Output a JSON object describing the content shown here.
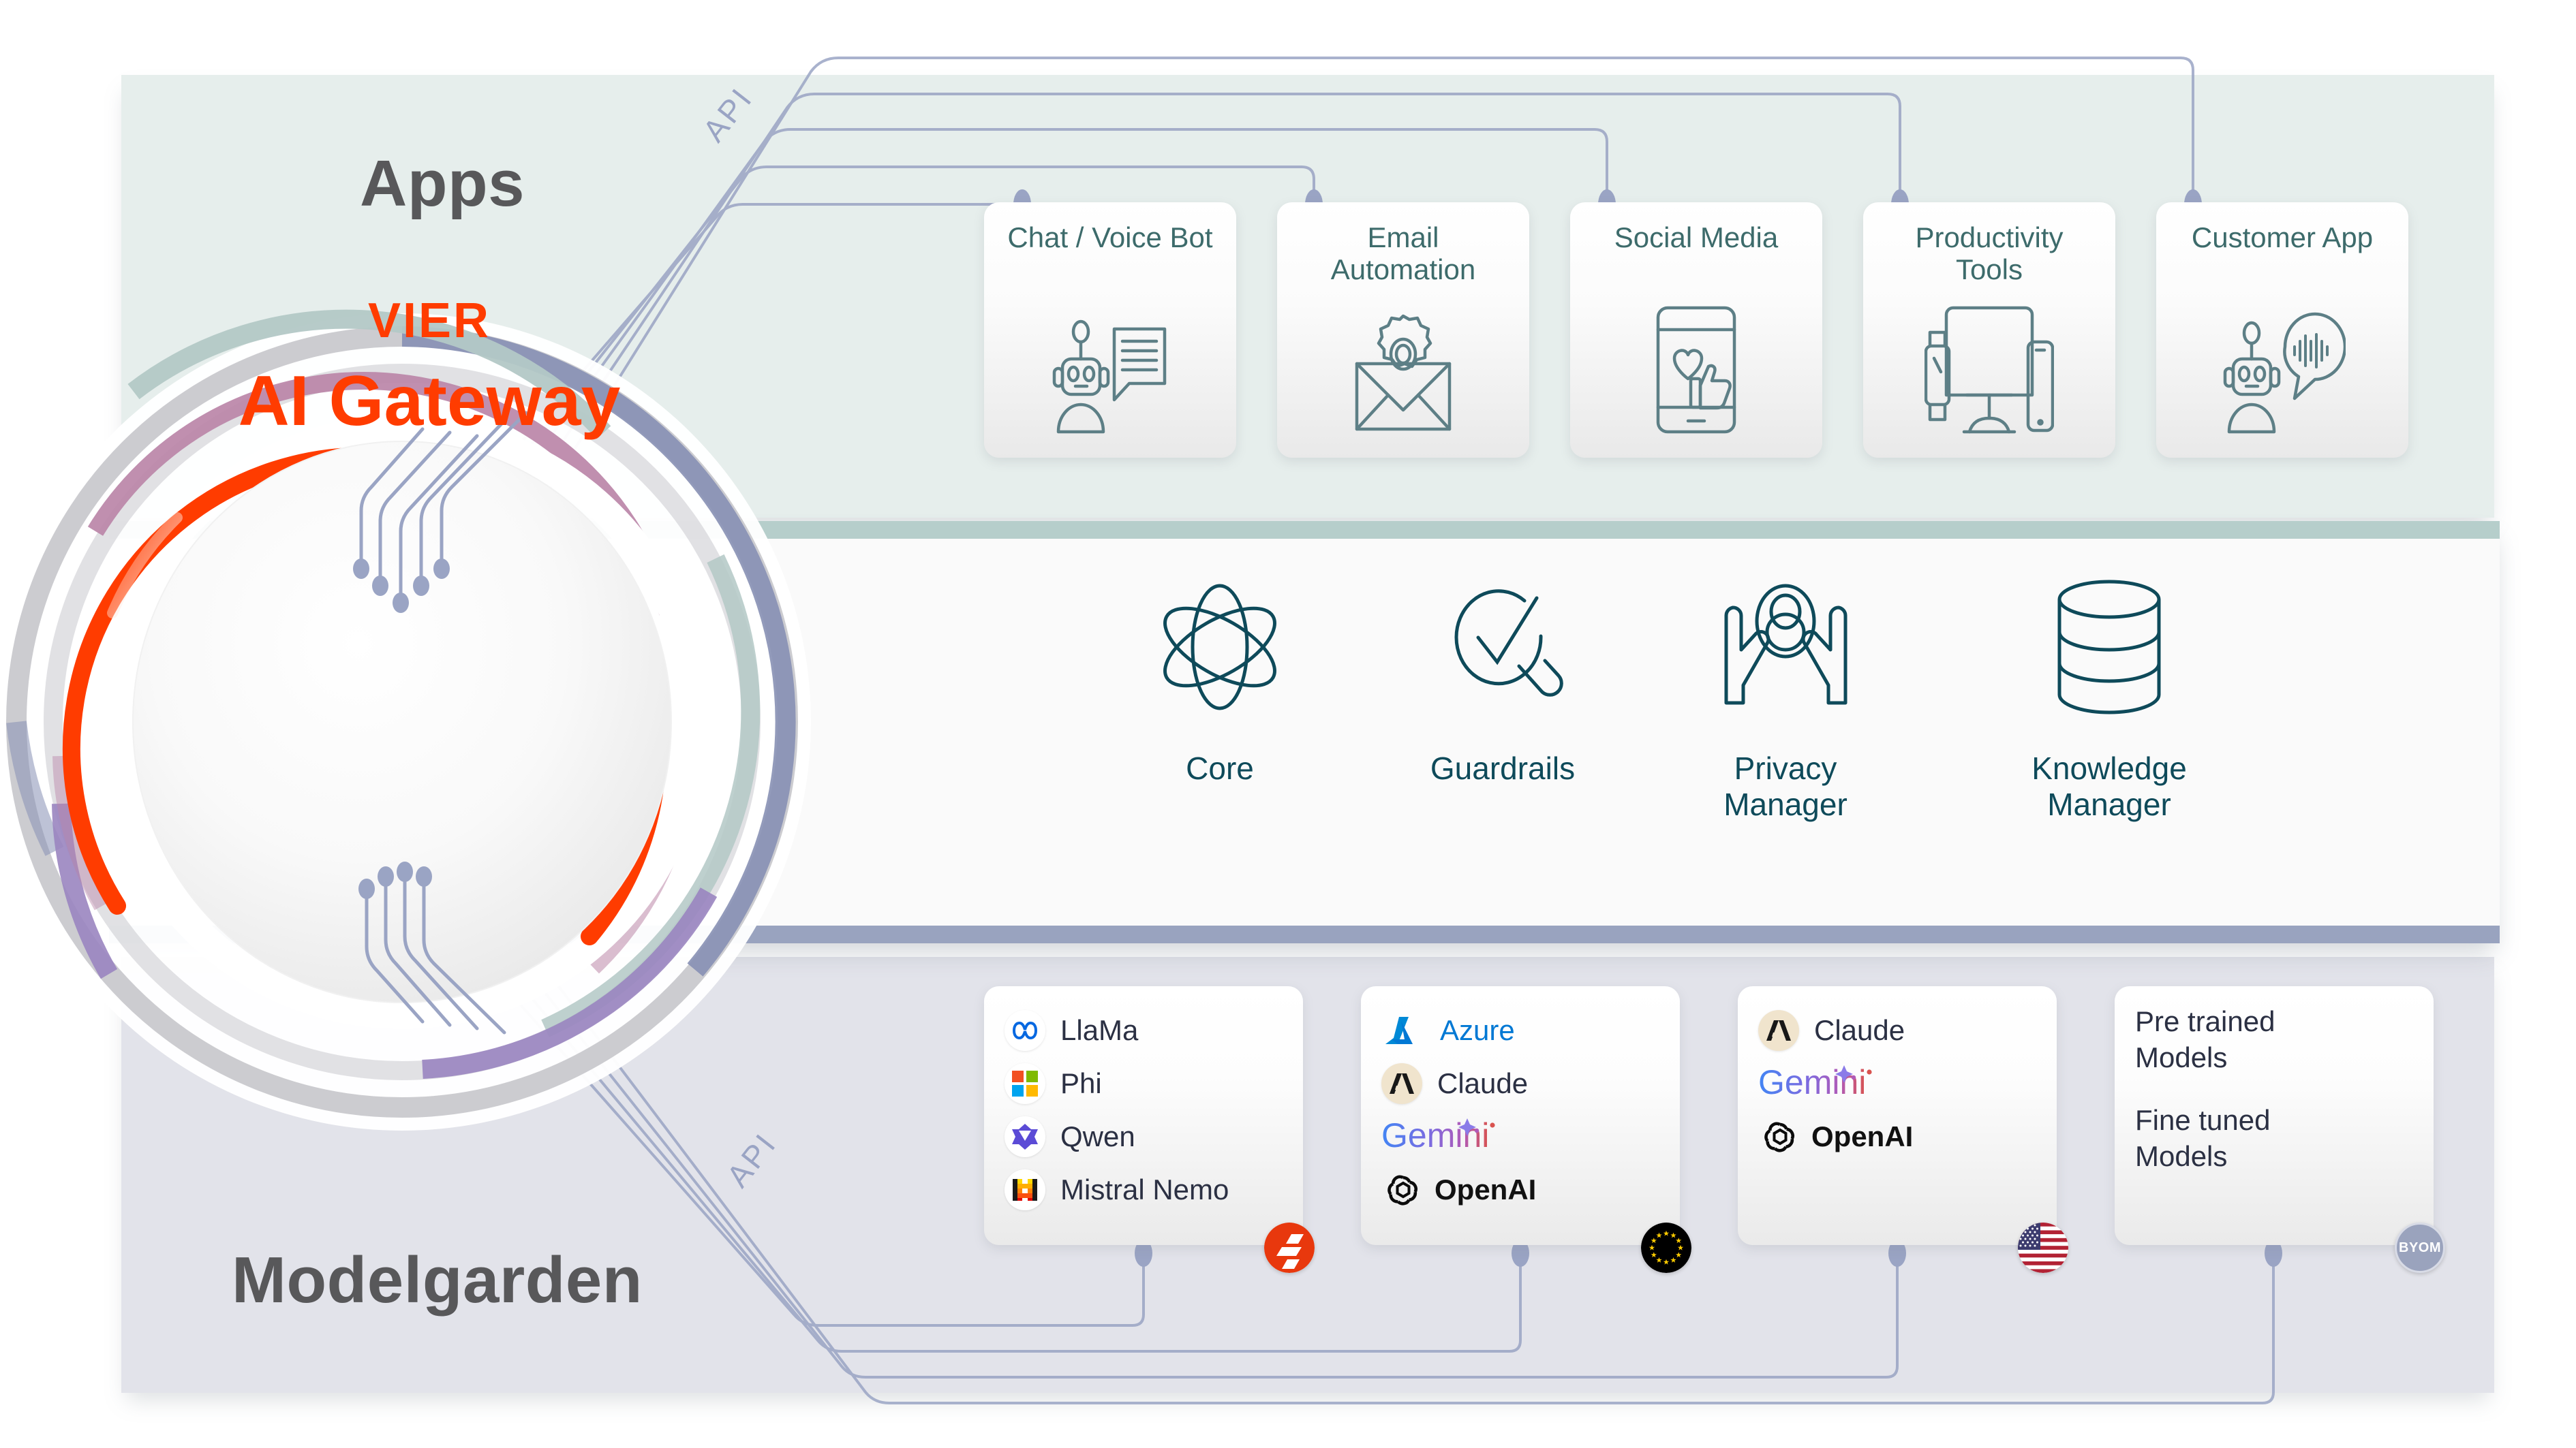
{
  "bands": {
    "apps": {
      "title": "Apps",
      "api_label": "API"
    },
    "gateway": {
      "brand": "VIER",
      "name": "AI Gateway"
    },
    "modelgarden": {
      "title": "Modelgarden",
      "api_label": "API"
    }
  },
  "apps": [
    {
      "label": "Chat / Voice Bot",
      "icon": "robot-chat-icon"
    },
    {
      "label": "Email\nAutomation",
      "label_line1": "Email",
      "label_line2": "Automation",
      "icon": "envelope-gear-icon"
    },
    {
      "label": "Social Media",
      "icon": "phone-heart-thumb-icon"
    },
    {
      "label": "Productivity\nTools",
      "label_line1": "Productivity",
      "label_line2": "Tools",
      "icon": "devices-icon"
    },
    {
      "label": "Customer App",
      "icon": "robot-voice-icon"
    }
  ],
  "gateway_features": [
    {
      "label": "Core",
      "icon": "atom-icon"
    },
    {
      "label": "Guardrails",
      "icon": "check-magnifier-icon"
    },
    {
      "label_line1": "Privacy",
      "label_line2": "Manager",
      "icon": "hands-person-icon"
    },
    {
      "label_line1": "Knowledge",
      "label_line2": "Manager",
      "icon": "database-icon"
    }
  ],
  "model_cards": [
    {
      "badge": "vier-logo-badge",
      "models": [
        {
          "name": "LlaMa",
          "logo": "meta-logo-icon",
          "bold": false
        },
        {
          "name": "Phi",
          "logo": "microsoft-logo-icon",
          "bold": false
        },
        {
          "name": "Qwen",
          "logo": "qwen-logo-icon",
          "bold": false
        },
        {
          "name": "Mistral Nemo",
          "logo": "mistral-logo-icon",
          "bold": false
        }
      ]
    },
    {
      "badge": "eu-flag-badge",
      "models": [
        {
          "name": "Azure",
          "logo": "azure-logo-icon",
          "bold": false,
          "style": "azure"
        },
        {
          "name": "Claude",
          "logo": "anthropic-logo-icon",
          "bold": false
        },
        {
          "name": "Gemini",
          "logo": "gemini-logo-icon",
          "bold": false,
          "style": "gemini"
        },
        {
          "name": "OpenAI",
          "logo": "openai-logo-icon",
          "bold": true
        }
      ]
    },
    {
      "badge": "us-flag-badge",
      "models": [
        {
          "name": "Claude",
          "logo": "anthropic-logo-icon",
          "bold": false
        },
        {
          "name": "Gemini",
          "logo": "gemini-logo-icon",
          "bold": false,
          "style": "gemini"
        },
        {
          "name": "OpenAI",
          "logo": "openai-logo-icon",
          "bold": true
        }
      ]
    },
    {
      "badge": "byom-badge",
      "badge_text": "BYOM",
      "text_lines": [
        "Pre trained Models",
        "Fine tuned Models"
      ],
      "line1a": "Pre trained",
      "line1b": "Models",
      "line2a": "Fine tuned",
      "line2b": "Models"
    }
  ],
  "colors": {
    "accent_orange": "#ff3c00",
    "apps_band": "#e6eeec",
    "gateway_band": "#fafafa",
    "gateway_band_top": "#b6cecb",
    "gateway_band_bottom": "#99a3bf",
    "models_band": "#e2e3ea",
    "app_label": "#3d6b6b",
    "feature_label": "#0e4a5a",
    "wire": "#9aa4c4"
  }
}
